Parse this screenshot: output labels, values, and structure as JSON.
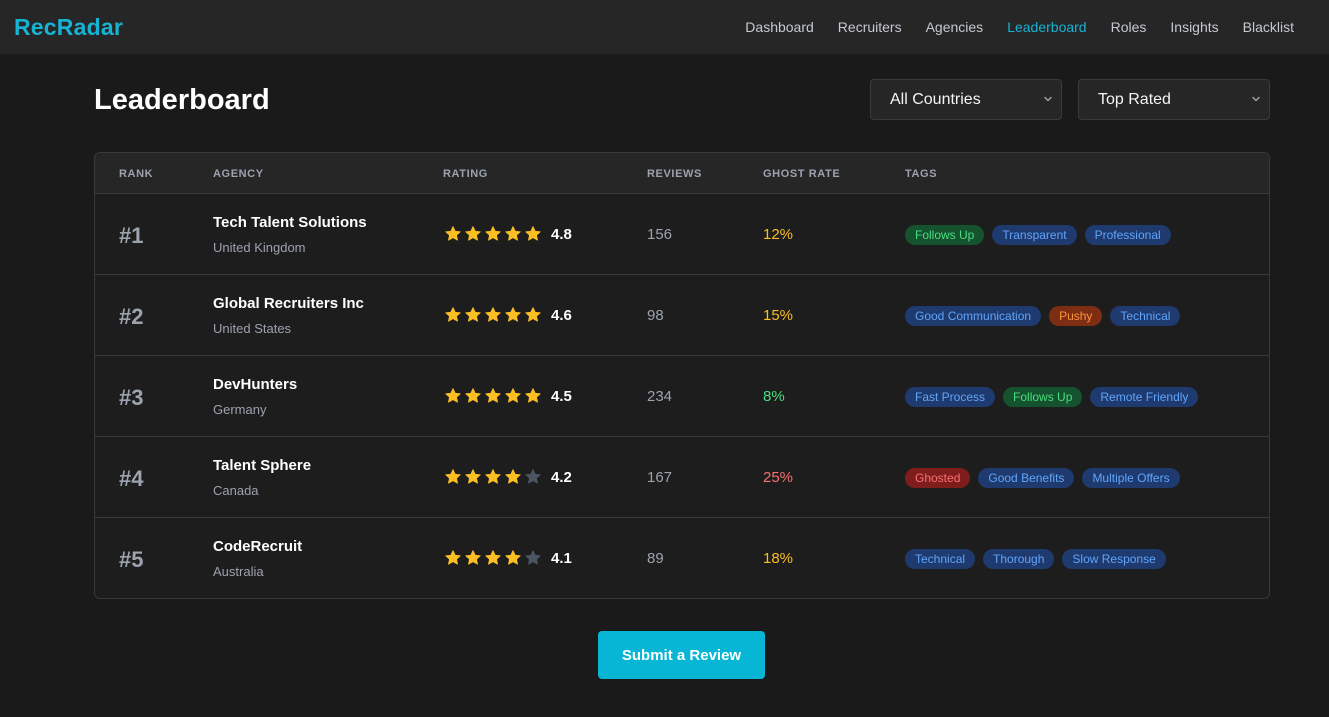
{
  "app": {
    "brand": "RecRadar"
  },
  "nav": {
    "items": [
      "Dashboard",
      "Recruiters",
      "Agencies",
      "Leaderboard",
      "Roles",
      "Insights",
      "Blacklist"
    ],
    "active": "Leaderboard"
  },
  "page": {
    "title": "Leaderboard"
  },
  "filters": {
    "country": {
      "selected": "All Countries"
    },
    "sort": {
      "selected": "Top Rated"
    }
  },
  "table": {
    "headers": {
      "rank": "RANK",
      "agency": "AGENCY",
      "rating": "RATING",
      "reviews": "REVIEWS",
      "ghost_rate": "GHOST RATE",
      "tags": "TAGS"
    },
    "rows": [
      {
        "rank": "#1",
        "name": "Tech Talent Solutions",
        "country": "United Kingdom",
        "rating": "4.8",
        "stars_filled": 5,
        "reviews": "156",
        "ghost_rate": "12%",
        "ghost_color": "#fbbf24",
        "tags": [
          {
            "label": "Follows Up",
            "color": "green"
          },
          {
            "label": "Transparent",
            "color": "blue"
          },
          {
            "label": "Professional",
            "color": "blue"
          }
        ]
      },
      {
        "rank": "#2",
        "name": "Global Recruiters Inc",
        "country": "United States",
        "rating": "4.6",
        "stars_filled": 5,
        "reviews": "98",
        "ghost_rate": "15%",
        "ghost_color": "#fbbf24",
        "tags": [
          {
            "label": "Good Communication",
            "color": "blue"
          },
          {
            "label": "Pushy",
            "color": "orange"
          },
          {
            "label": "Technical",
            "color": "blue"
          }
        ]
      },
      {
        "rank": "#3",
        "name": "DevHunters",
        "country": "Germany",
        "rating": "4.5",
        "stars_filled": 5,
        "reviews": "234",
        "ghost_rate": "8%",
        "ghost_color": "#4ade80",
        "tags": [
          {
            "label": "Fast Process",
            "color": "blue"
          },
          {
            "label": "Follows Up",
            "color": "green"
          },
          {
            "label": "Remote Friendly",
            "color": "blue"
          }
        ]
      },
      {
        "rank": "#4",
        "name": "Talent Sphere",
        "country": "Canada",
        "rating": "4.2",
        "stars_filled": 4,
        "reviews": "167",
        "ghost_rate": "25%",
        "ghost_color": "#f87171",
        "tags": [
          {
            "label": "Ghosted",
            "color": "red"
          },
          {
            "label": "Good Benefits",
            "color": "blue"
          },
          {
            "label": "Multiple Offers",
            "color": "blue"
          }
        ]
      },
      {
        "rank": "#5",
        "name": "CodeRecruit",
        "country": "Australia",
        "rating": "4.1",
        "stars_filled": 4,
        "reviews": "89",
        "ghost_rate": "18%",
        "ghost_color": "#fbbf24",
        "tags": [
          {
            "label": "Technical",
            "color": "blue"
          },
          {
            "label": "Thorough",
            "color": "blue"
          },
          {
            "label": "Slow Response",
            "color": "blue"
          }
        ]
      }
    ]
  },
  "actions": {
    "submit_label": "Submit a Review"
  },
  "colors": {
    "accent": "#06b6d4",
    "star_filled": "#fbbf24",
    "star_empty": "#4b5563"
  },
  "icons": {
    "star": "star-icon",
    "select_arrow": "chevron-down-icon"
  }
}
